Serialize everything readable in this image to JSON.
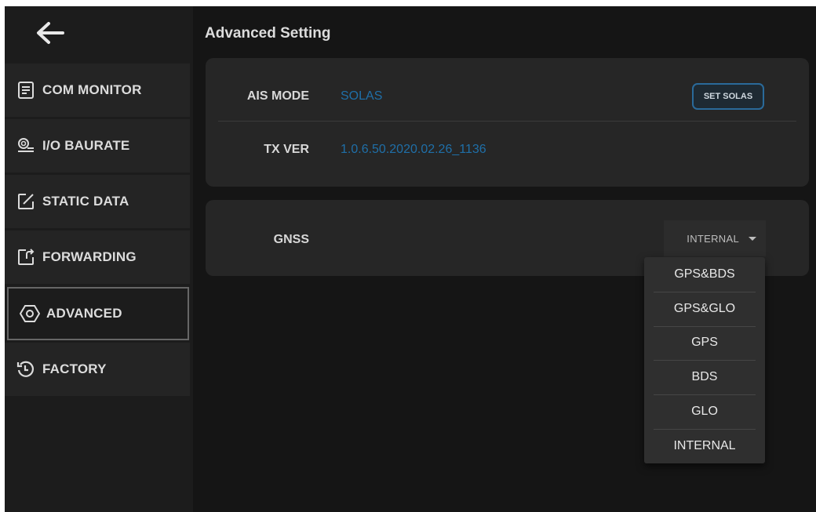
{
  "header": {
    "title": "Advanced Setting"
  },
  "sidebar": {
    "back_icon": "arrow-left-icon",
    "items": [
      {
        "label": "COM MONITOR",
        "icon": "receipt-icon"
      },
      {
        "label": "I/O BAURATE",
        "icon": "sensor-icon"
      },
      {
        "label": "STATIC DATA",
        "icon": "edit-square-icon"
      },
      {
        "label": "FORWARDING",
        "icon": "forward-box-icon"
      },
      {
        "label": "ADVANCED",
        "icon": "hexagon-settings-icon",
        "active": true
      },
      {
        "label": "FACTORY",
        "icon": "restore-icon"
      }
    ]
  },
  "info": {
    "ais_mode_label": "AIS MODE",
    "ais_mode_value": "SOLAS",
    "set_button": "SET SOLAS",
    "tx_ver_label": "TX VER",
    "tx_ver_value": "1.0.6.50.2020.02.26_1136"
  },
  "gnss": {
    "label": "GNSS",
    "selected": "INTERNAL",
    "options": [
      "GPS&BDS",
      "GPS&GLO",
      "GPS",
      "BDS",
      "GLO",
      "INTERNAL"
    ]
  },
  "colors": {
    "background": "#151515",
    "sidebar": "#1c1c1c",
    "card": "#262626",
    "accent_value": "#1f6fa8",
    "button_border": "#2a6a9a"
  }
}
